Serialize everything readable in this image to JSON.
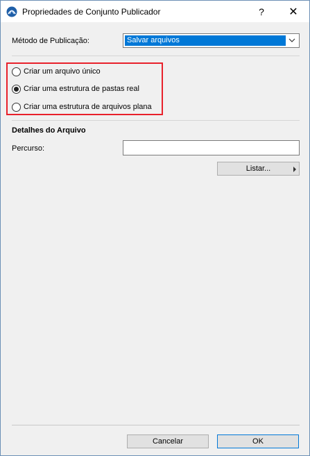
{
  "window": {
    "title": "Propriedades de Conjunto Publicador",
    "help_label": "?",
    "close_label": "✕"
  },
  "publish_method": {
    "label": "Método de Publicação:",
    "selected": "Salvar arquivos"
  },
  "options": [
    {
      "label": "Criar um arquivo único",
      "checked": false
    },
    {
      "label": "Criar uma estrutura de pastas real",
      "checked": true
    },
    {
      "label": "Criar uma estrutura de arquivos plana",
      "checked": false
    }
  ],
  "file_details": {
    "title": "Detalhes do Arquivo",
    "path_label": "Percurso:",
    "path_value": "",
    "list_button": "Listar..."
  },
  "footer": {
    "cancel_label": "Cancelar",
    "ok_label": "OK"
  },
  "colors": {
    "selection": "#0078d7",
    "highlight_frame": "#e8202a"
  }
}
